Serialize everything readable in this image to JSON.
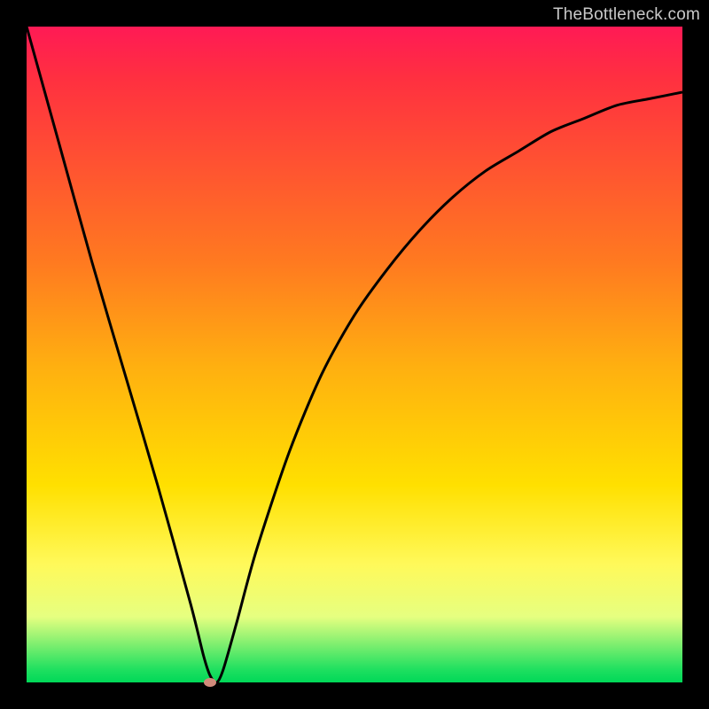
{
  "watermark": "TheBottleneck.com",
  "colors": {
    "frame_bg": "#000000",
    "curve": "#000000",
    "dot": "#d08a7a",
    "gradient_top": "#ff1a55",
    "gradient_bottom": "#00d858"
  },
  "chart_data": {
    "type": "line",
    "title": "",
    "xlabel": "",
    "ylabel": "",
    "xlim": [
      0,
      100
    ],
    "ylim": [
      0,
      100
    ],
    "grid": false,
    "legend": false,
    "series": [
      {
        "name": "bottleneck-curve",
        "x": [
          0,
          5,
          10,
          15,
          20,
          25,
          27,
          28,
          29,
          30,
          32,
          35,
          40,
          45,
          50,
          55,
          60,
          65,
          70,
          75,
          80,
          85,
          90,
          95,
          100
        ],
        "values": [
          100,
          82,
          64,
          47,
          30,
          12,
          4,
          1,
          0,
          2,
          9,
          20,
          35,
          47,
          56,
          63,
          69,
          74,
          78,
          81,
          84,
          86,
          88,
          89,
          90
        ]
      }
    ],
    "minimum_point": {
      "x": 28,
      "y": 0
    },
    "annotations": []
  }
}
